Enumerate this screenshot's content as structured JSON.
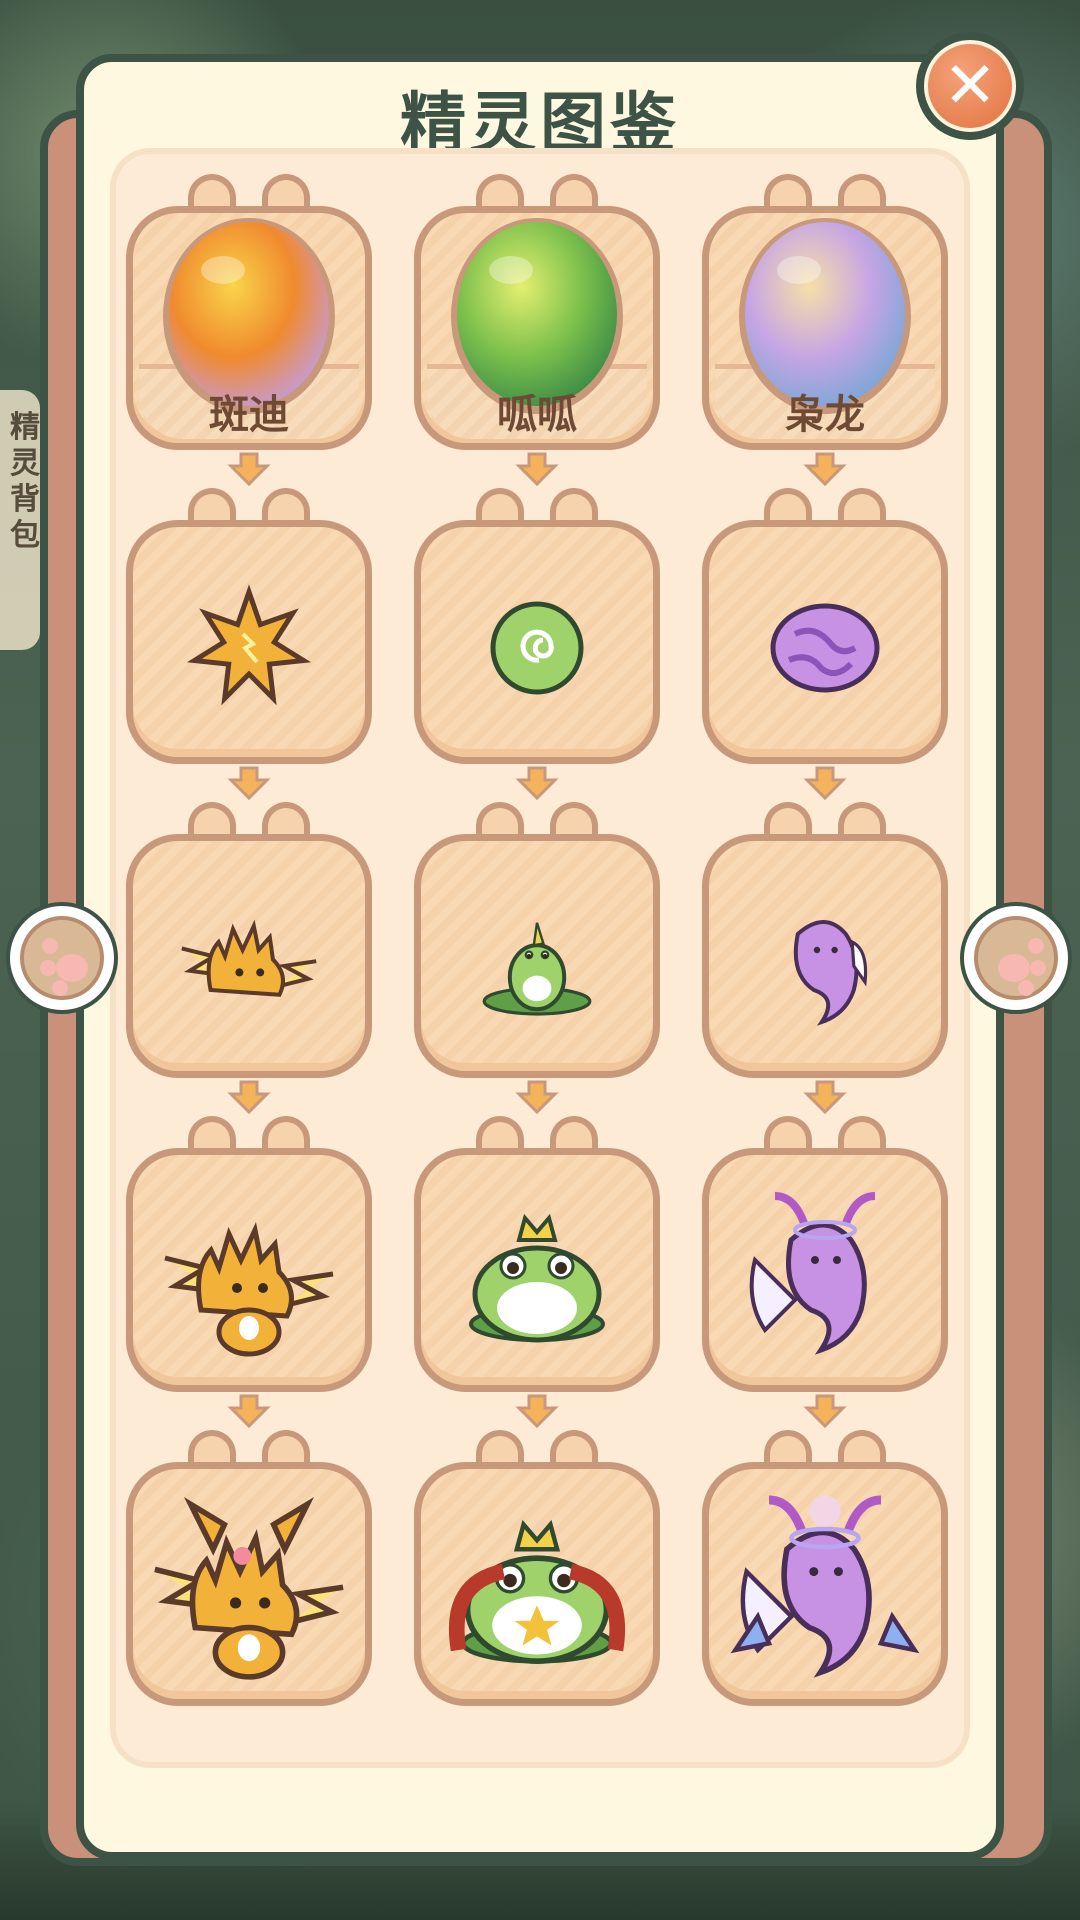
{
  "title": "精灵图鉴",
  "close_symbol": "✕",
  "side_tab_text": "精灵背包",
  "columns": [
    {
      "name": "斑迪",
      "element": "fire",
      "stages": [
        "egg",
        "spark-orb",
        "fire-sprite",
        "fire-cub",
        "fire-fox"
      ]
    },
    {
      "name": "呱呱",
      "element": "grass",
      "stages": [
        "egg",
        "leaf-orb",
        "sprout-frog",
        "crowned-frog",
        "king-frog"
      ]
    },
    {
      "name": "枭龙",
      "element": "mystic",
      "stages": [
        "egg",
        "dream-orb",
        "ghost-sprite",
        "ghost-dragon",
        "mystic-dragon"
      ]
    }
  ],
  "colors": {
    "panel_border": "#3d5346",
    "panel_bg": "#fff8e1",
    "card_border": "#c8987b",
    "close_button": "#e2733f"
  },
  "icons": [
    "close-icon",
    "paw-left-icon",
    "paw-right-icon",
    "down-arrow-icon"
  ]
}
